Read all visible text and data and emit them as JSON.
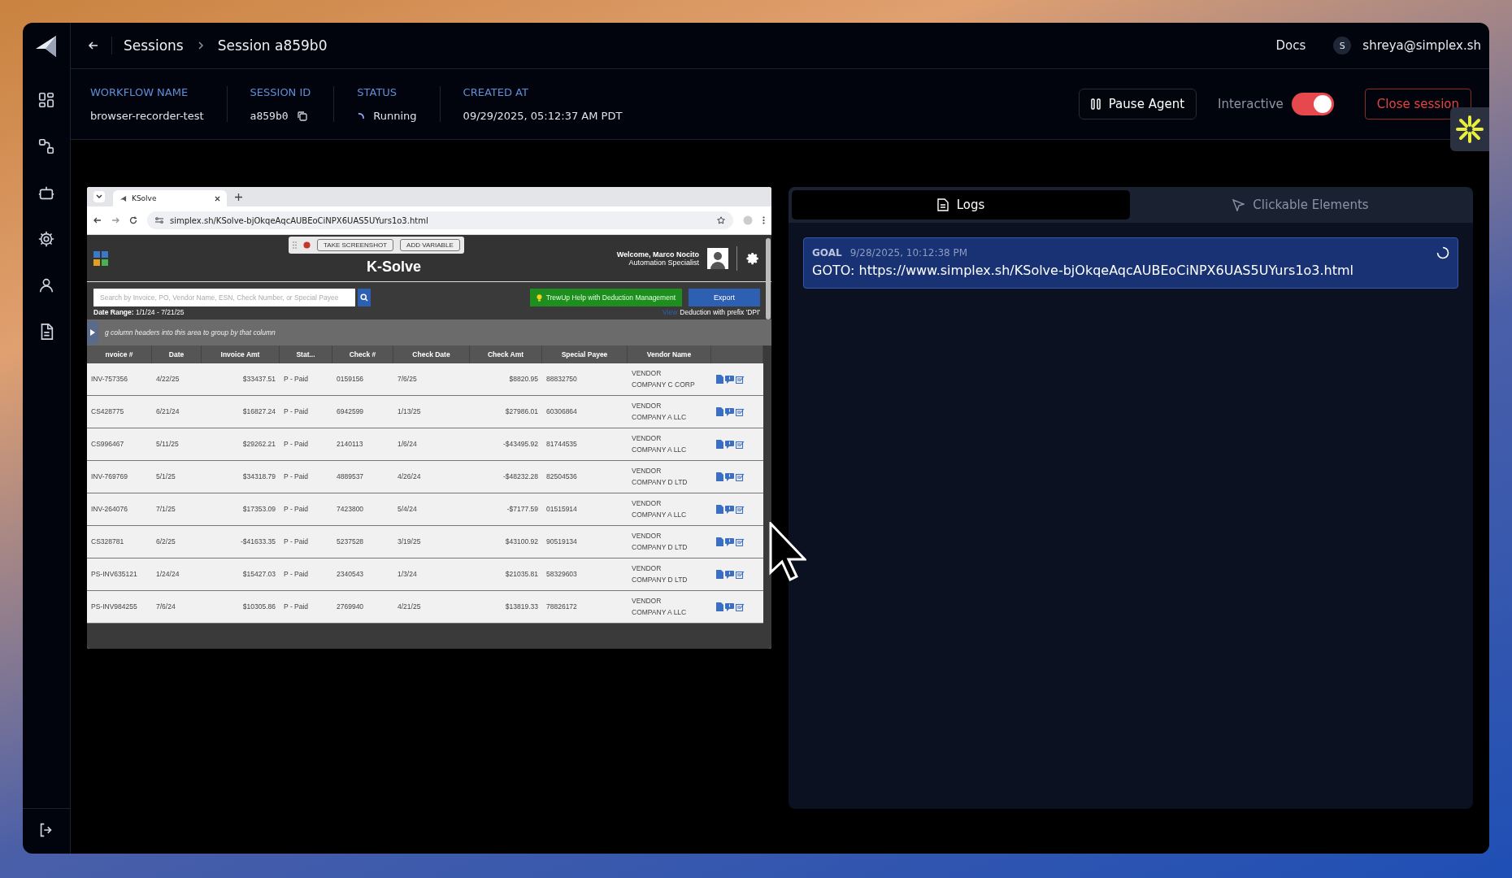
{
  "sidebar": {
    "items": [
      {
        "kind": "grid"
      },
      {
        "kind": "flow"
      },
      {
        "kind": "bot"
      },
      {
        "kind": "gear"
      },
      {
        "kind": "person"
      },
      {
        "kind": "document"
      }
    ],
    "bottom": [
      {
        "kind": "logout"
      }
    ]
  },
  "breadcrumb": [
    "Sessions",
    "Session a859b0"
  ],
  "top_links": {
    "docs": "Docs",
    "user_initial": "S",
    "user_email": "shreya@simplex.sh"
  },
  "session_info": [
    {
      "label": "WORKFLOW NAME",
      "value": "browser-recorder-test",
      "kind": "text"
    },
    {
      "label": "SESSION ID",
      "value": "a859b0",
      "kind": "id"
    },
    {
      "label": "STATUS",
      "value": "Running",
      "kind": "status"
    },
    {
      "label": "CREATED AT",
      "value": "09/29/2025, 05:12:37 AM PDT",
      "kind": "text"
    }
  ],
  "actions": {
    "pause": "Pause Agent",
    "interactive": {
      "label": "Interactive",
      "on": true
    },
    "close": "Close session"
  },
  "browser": {
    "tab_title": "KSolve",
    "url": "simplex.sh/KSolve-bjOkqeAqcAUBEoCiNPX6UAS5UYurs1o3.html",
    "recorder_buttons": [
      "TAKE SCREENSHOT",
      "ADD VARIABLE"
    ],
    "app": {
      "title": "K-Solve",
      "welcome": "Welcome, Marco Nocito",
      "role": "Automation Specialist",
      "search_placeholder": "Search by Invoice, PO, Vendor Name, ESN, Check Number, or Special Payee",
      "help_button": "TrewUp Help with Deduction Management",
      "export_button": "Export",
      "date_range_label": "Date Range:",
      "date_range": "1/1/24 - 7/21/25",
      "view_link": "View",
      "view_note": "Deduction with prefix 'DPI'",
      "group_hint": "g column headers into this area to group by that column",
      "columns": [
        "nvoice #",
        "Date",
        "Invoice Amt",
        "Stat...",
        "Check #",
        "Check Date",
        "Check Amt",
        "Special Payee",
        "Vendor Name"
      ],
      "rows": [
        [
          "INV-757356",
          "4/22/25",
          "$33437.51",
          "P - Paid",
          "0159156",
          "7/6/25",
          "$8820.95",
          "88832750",
          "VENDOR\nCOMPANY C CORP"
        ],
        [
          "CS428775",
          "6/21/24",
          "$16827.24",
          "P - Paid",
          "6942599",
          "1/13/25",
          "$27986.01",
          "60306864",
          "VENDOR\nCOMPANY A LLC"
        ],
        [
          "CS996467",
          "5/11/25",
          "$29262.21",
          "P - Paid",
          "2140113",
          "1/6/24",
          "-$43495.92",
          "81744535",
          "VENDOR\nCOMPANY A LLC"
        ],
        [
          "INV-769769",
          "5/1/25",
          "$34318.79",
          "P - Paid",
          "4889537",
          "4/26/24",
          "-$48232.28",
          "82504536",
          "VENDOR\nCOMPANY D LTD"
        ],
        [
          "INV-264076",
          "7/1/25",
          "$17353.09",
          "P - Paid",
          "7423800",
          "5/4/24",
          "-$7177.59",
          "01515914",
          "VENDOR\nCOMPANY A LLC"
        ],
        [
          "CS328781",
          "6/2/25",
          "-$41633.35",
          "P - Paid",
          "5237528",
          "3/19/25",
          "$43100.92",
          "90519134",
          "VENDOR\nCOMPANY D LTD"
        ],
        [
          "PS-INV635121",
          "1/24/24",
          "$15427.03",
          "P - Paid",
          "2340543",
          "1/3/24",
          "$21035.81",
          "58329603",
          "VENDOR\nCOMPANY D LTD"
        ],
        [
          "PS-INV984255",
          "7/6/24",
          "$10305.86",
          "P - Paid",
          "2769940",
          "4/21/25",
          "$13819.33",
          "78826172",
          "VENDOR\nCOMPANY A LLC"
        ]
      ]
    }
  },
  "logs_panel": {
    "tabs": [
      {
        "label": "Logs",
        "selected": true,
        "kind": "logs"
      },
      {
        "label": "Clickable Elements",
        "selected": false,
        "kind": "pointer"
      }
    ],
    "entries": [
      {
        "type": "GOAL",
        "time": "9/28/2025, 10:12:38 PM",
        "text": "GOTO: https://www.simplex.sh/KSolve-bjOkqeAqcAUBEoCiNPX6UAS5UYurs1o3.html",
        "loading": true
      }
    ]
  }
}
